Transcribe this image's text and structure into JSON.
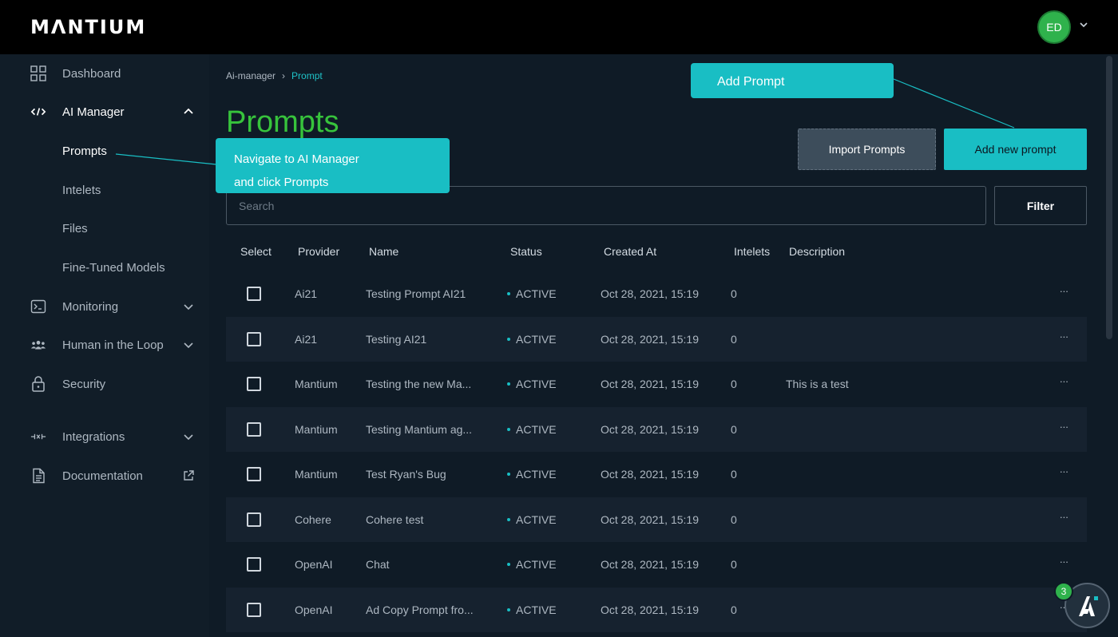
{
  "app": {
    "logo": "MΛNTIUM",
    "user_initials": "ED"
  },
  "sidebar": {
    "items": [
      {
        "label": "Dashboard",
        "icon": "grid-icon"
      },
      {
        "label": "AI Manager",
        "icon": "code-icon"
      },
      {
        "label": "Monitoring",
        "icon": "terminal-icon"
      },
      {
        "label": "Human in the Loop",
        "icon": "people-icon"
      },
      {
        "label": "Security",
        "icon": "lock-icon"
      },
      {
        "label": "Integrations",
        "icon": "plug-icon"
      },
      {
        "label": "Documentation",
        "icon": "document-icon"
      }
    ],
    "ai_manager_sub": [
      "Prompts",
      "Intelets",
      "Files",
      "Fine-Tuned Models"
    ]
  },
  "breadcrumb": {
    "parent": "Ai-manager",
    "separator": "›",
    "current": "Prompt"
  },
  "page": {
    "title": "Prompts"
  },
  "buttons": {
    "import": "Import Prompts",
    "add": "Add new prompt",
    "filter": "Filter"
  },
  "search": {
    "placeholder": "Search",
    "value": ""
  },
  "table": {
    "columns": [
      "Select",
      "Provider",
      "Name",
      "Status",
      "Created At",
      "Intelets",
      "Description"
    ],
    "rows": [
      {
        "provider": "Ai21",
        "name": "Testing Prompt AI21",
        "status": "ACTIVE",
        "created": "Oct 28, 2021, 15:19",
        "intelets": "0",
        "description": "",
        "more": "..."
      },
      {
        "provider": "Ai21",
        "name": "Testing AI21",
        "status": "ACTIVE",
        "created": "Oct 28, 2021, 15:19",
        "intelets": "0",
        "description": "",
        "more": "..."
      },
      {
        "provider": "Mantium",
        "name": "Testing the new Ma...",
        "status": "ACTIVE",
        "created": "Oct 28, 2021, 15:19",
        "intelets": "0",
        "description": "This is a test",
        "more": "..."
      },
      {
        "provider": "Mantium",
        "name": "Testing Mantium ag...",
        "status": "ACTIVE",
        "created": "Oct 28, 2021, 15:19",
        "intelets": "0",
        "description": "",
        "more": "..."
      },
      {
        "provider": "Mantium",
        "name": "Test Ryan's Bug",
        "status": "ACTIVE",
        "created": "Oct 28, 2021, 15:19",
        "intelets": "0",
        "description": "",
        "more": "..."
      },
      {
        "provider": "Cohere",
        "name": "Cohere test",
        "status": "ACTIVE",
        "created": "Oct 28, 2021, 15:19",
        "intelets": "0",
        "description": "",
        "more": "..."
      },
      {
        "provider": "OpenAI",
        "name": "Chat",
        "status": "ACTIVE",
        "created": "Oct 28, 2021, 15:19",
        "intelets": "0",
        "description": "",
        "more": "..."
      },
      {
        "provider": "OpenAI",
        "name": "Ad Copy Prompt fro...",
        "status": "ACTIVE",
        "created": "Oct 28, 2021, 15:19",
        "intelets": "0",
        "description": "",
        "more": "..."
      }
    ]
  },
  "callouts": {
    "add_prompt": "Add Prompt",
    "navigate_line1": "Navigate to AI Manager",
    "navigate_line2": "and click Prompts"
  },
  "widget": {
    "badge": "3",
    "icon": "assistant-icon"
  },
  "colors": {
    "accent": "#19bec4",
    "title_green": "#37c33c",
    "avatar_green": "#2fb24c",
    "background": "#0f1b26"
  }
}
